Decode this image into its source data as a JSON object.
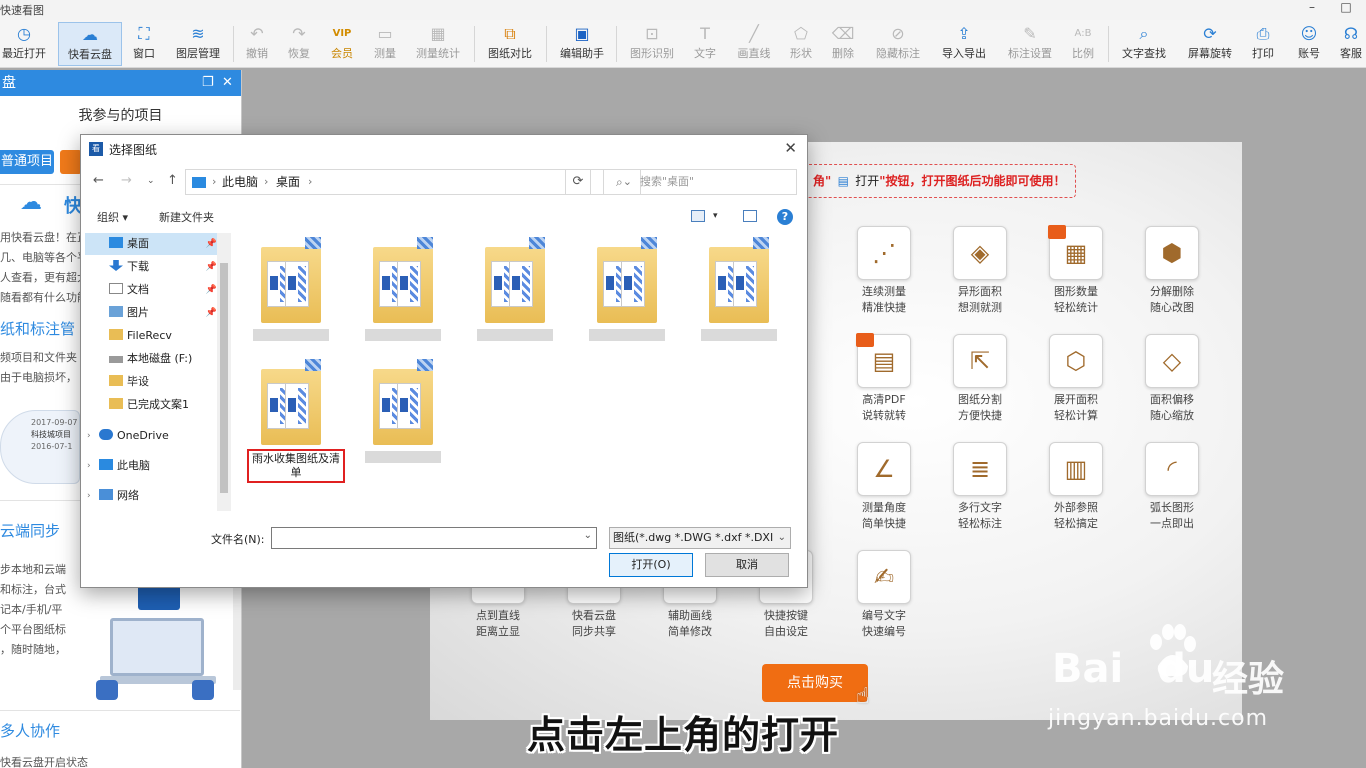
{
  "app": {
    "title": "快速看图"
  },
  "toolbar": {
    "items": [
      {
        "label": "最近打开",
        "icon": "clock-icon"
      },
      {
        "label": "快看云盘",
        "icon": "cloud-icon"
      },
      {
        "label": "窗口",
        "icon": "window-icon"
      },
      {
        "label": "图层管理",
        "icon": "layers-icon"
      },
      {
        "label": "撤销",
        "icon": "undo-icon"
      },
      {
        "label": "恢复",
        "icon": "redo-icon"
      },
      {
        "label": "会员",
        "icon": "vip-icon",
        "icon_text": "VIP"
      },
      {
        "label": "测量",
        "icon": "ruler-icon"
      },
      {
        "label": "测量统计",
        "icon": "measure-stats-icon"
      },
      {
        "label": "图纸对比",
        "icon": "compare-icon"
      },
      {
        "label": "编辑助手",
        "icon": "edit-assistant-icon"
      },
      {
        "label": "图形识别",
        "icon": "shape-recognize-icon"
      },
      {
        "label": "文字",
        "icon": "text-icon",
        "icon_text": "T"
      },
      {
        "label": "画直线",
        "icon": "line-icon"
      },
      {
        "label": "形状",
        "icon": "shape-icon"
      },
      {
        "label": "删除",
        "icon": "eraser-icon"
      },
      {
        "label": "隐藏标注",
        "icon": "eye-hide-icon"
      },
      {
        "label": "导入导出",
        "icon": "import-export-icon"
      },
      {
        "label": "标注设置",
        "icon": "annotation-settings-icon"
      },
      {
        "label": "比例",
        "icon": "scale-icon",
        "icon_text": "A:B"
      },
      {
        "label": "文字查找",
        "icon": "text-search-icon"
      },
      {
        "label": "屏幕旋转",
        "icon": "rotate-screen-icon"
      },
      {
        "label": "打印",
        "icon": "printer-icon"
      },
      {
        "label": "账号",
        "icon": "user-icon"
      },
      {
        "label": "客服",
        "icon": "headset-icon"
      }
    ]
  },
  "left_panel": {
    "header": "盘",
    "my_projects": "我参与的项目",
    "btn_normal": "普通项目",
    "brand_char": "快",
    "intro_lines": [
      "用快看云盘！在正",
      "几、电脑等各个平",
      "人查看，更有超大",
      "随看都有什么功能"
    ],
    "section2_title": "纸和标注管",
    "section2_lines": [
      "频项目和文件夹",
      "由于电脑损坏，"
    ],
    "card_date1": "2017-09-07",
    "card_label": "科技城项目",
    "card_date2": "2016-07-1",
    "section3_title": "云端同步",
    "section3_lines": [
      "步本地和云端",
      "和标注，台式",
      "记本/手机/平",
      "个平台图纸标",
      "，随时随地，"
    ],
    "section4_title": "多人协作",
    "status": "快看云盘开启状态"
  },
  "dialog": {
    "title": "选择图纸",
    "address": [
      "此电脑",
      "桌面"
    ],
    "search_placeholder": "搜索\"桌面\"",
    "organize": "组织 ▾",
    "new_folder": "新建文件夹",
    "nav_items": [
      {
        "label": "桌面",
        "selected": true,
        "pinned": true
      },
      {
        "label": "下载",
        "pinned": true
      },
      {
        "label": "文档",
        "pinned": true
      },
      {
        "label": "图片",
        "pinned": true
      },
      {
        "label": "FileRecv"
      },
      {
        "label": "本地磁盘 (F:)"
      },
      {
        "label": "毕设"
      },
      {
        "label": "已完成文案1"
      },
      {
        "label": "OneDrive"
      },
      {
        "label": "此电脑"
      },
      {
        "label": "网络"
      }
    ],
    "highlighted_file": "雨水收集图纸及清单",
    "filename_label": "文件名(N):",
    "filename_value": "",
    "filter": "图纸(*.dwg *.DWG *.dxf *.DXI",
    "open_button": "打开(O)",
    "cancel_button": "取消"
  },
  "welcome": {
    "notice_pre": "角\"",
    "notice_open": "打开",
    "notice_post": "\"按钮，打开图纸后功能即可使用！",
    "features": [
      {
        "l1": "连续测量",
        "l2": "精准快捷",
        "icon": "continuous-measure-icon"
      },
      {
        "l1": "异形面积",
        "l2": "想测就测",
        "icon": "irregular-area-icon"
      },
      {
        "l1": "图形数量",
        "l2": "轻松统计",
        "icon": "shape-count-icon",
        "tag": true
      },
      {
        "l1": "分解删除",
        "l2": "随心改图",
        "icon": "explode-delete-icon"
      },
      {
        "l1": "高清PDF",
        "l2": "说转就转",
        "icon": "pdf-icon",
        "tag": true
      },
      {
        "l1": "图纸分割",
        "l2": "方便快捷",
        "icon": "split-drawing-icon"
      },
      {
        "l1": "展开面积",
        "l2": "轻松计算",
        "icon": "unfold-area-icon"
      },
      {
        "l1": "面积偏移",
        "l2": "随心缩放",
        "icon": "area-offset-icon"
      },
      {
        "l1": "测量角度",
        "l2": "简单快捷",
        "icon": "angle-measure-icon"
      },
      {
        "l1": "多行文字",
        "l2": "轻松标注",
        "icon": "multiline-text-icon"
      },
      {
        "l1": "外部参照",
        "l2": "轻松搞定",
        "icon": "xref-icon"
      },
      {
        "l1": "弧长图形",
        "l2": "一点即出",
        "icon": "arc-length-icon"
      },
      {
        "l1": "点到直线",
        "l2": "距离立显",
        "icon": "point-line-icon"
      },
      {
        "l1": "快看云盘",
        "l2": "同步共享",
        "icon": "cloud-sync-icon"
      },
      {
        "l1": "辅助画线",
        "l2": "简单修改",
        "icon": "assist-line-icon"
      },
      {
        "l1": "快捷按键",
        "l2": "自由设定",
        "icon": "shortcut-icon"
      },
      {
        "l1": "编号文字",
        "l2": "快速编号",
        "icon": "number-text-icon"
      }
    ],
    "buy_button": "点击购买"
  },
  "subtitle": "点击左上角的打开",
  "watermark": {
    "brand": "Bai",
    "brand2": "du",
    "jingyan": "经验",
    "url": "jingyan.baidu.com"
  },
  "colors": {
    "accent": "#2e8ae0",
    "buy": "#f06d12",
    "notice": "#dd2222",
    "highlight_border": "#e02020"
  }
}
